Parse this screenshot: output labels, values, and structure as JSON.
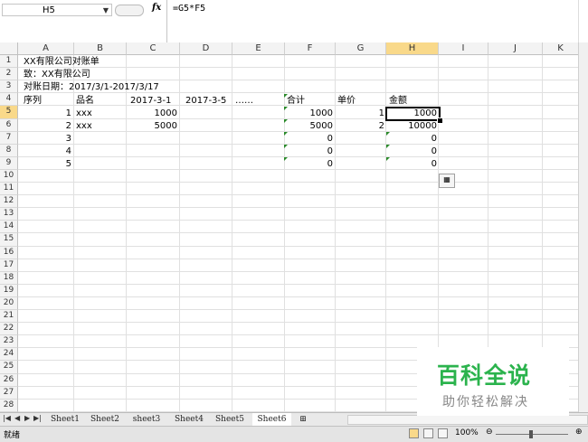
{
  "formula_bar": {
    "name_box": "H5",
    "formula": "=G5*F5",
    "fx_label": "fx"
  },
  "columns": [
    "A",
    "B",
    "C",
    "D",
    "E",
    "F",
    "G",
    "H",
    "I",
    "J",
    "K"
  ],
  "rows": [
    "1",
    "2",
    "3",
    "4",
    "5",
    "6",
    "7",
    "8",
    "9",
    "10",
    "11",
    "12",
    "13",
    "14",
    "15",
    "16",
    "17",
    "18",
    "19",
    "20",
    "21",
    "22",
    "23",
    "24",
    "25",
    "26",
    "27",
    "28"
  ],
  "sheet": {
    "title": "XX有限公司对账单",
    "to": "致：XX有限公司",
    "period": "对账日期：2017/3/1-2017/3/17",
    "headers": {
      "seq": "序列",
      "name": "品名",
      "d1": "2017-3-1",
      "d2": "2017-3-5",
      "more": "……",
      "total": "合计",
      "price": "单价",
      "amount": "金额"
    },
    "data": [
      {
        "seq": "1",
        "name": "xxx",
        "d1": "1000",
        "total": "1000",
        "price": "1",
        "amount": "1000"
      },
      {
        "seq": "2",
        "name": "xxx",
        "d1": "5000",
        "total": "5000",
        "price": "2",
        "amount": "10000"
      },
      {
        "seq": "3",
        "name": "",
        "d1": "",
        "total": "0",
        "price": "",
        "amount": "0"
      },
      {
        "seq": "4",
        "name": "",
        "d1": "",
        "total": "0",
        "price": "",
        "amount": "0"
      },
      {
        "seq": "5",
        "name": "",
        "d1": "",
        "total": "0",
        "price": "",
        "amount": "0"
      }
    ]
  },
  "tabs": [
    "Sheet1",
    "Sheet2",
    "sheet3",
    "Sheet4",
    "Sheet5",
    "Sheet6"
  ],
  "active_tab": "Sheet6",
  "status": {
    "ready": "就绪",
    "zoom": "100%"
  },
  "watermark": {
    "title": "百科全说",
    "subtitle": "助你轻松解决"
  }
}
